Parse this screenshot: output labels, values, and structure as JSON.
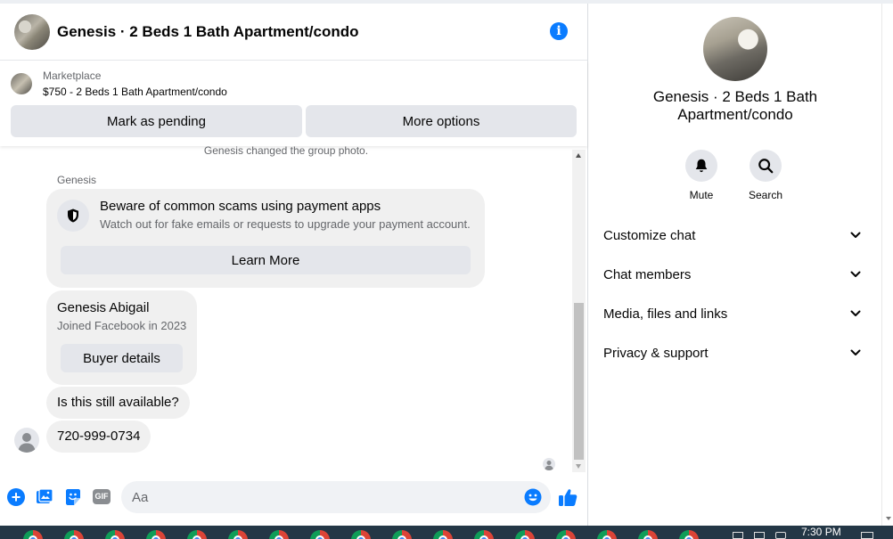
{
  "chat": {
    "title": "Genesis · 2 Beds 1 Bath Apartment/condo",
    "listing": {
      "source": "Marketplace",
      "title": "$750 - 2 Beds 1 Bath Apartment/condo"
    },
    "buttons": {
      "mark_pending": "Mark as pending",
      "more_options": "More options"
    },
    "system_note": "Genesis changed the group photo.",
    "sender_name": "Genesis",
    "scam_notice": {
      "title": "Beware of common scams using payment apps",
      "body": "Watch out for fake emails or requests to upgrade your payment account.",
      "button": "Learn More"
    },
    "buyer": {
      "name": "Genesis Abigail",
      "joined": "Joined Facebook in 2023",
      "button": "Buyer details"
    },
    "messages": [
      {
        "text": "Is this still available?"
      },
      {
        "text": "720-999-0734"
      }
    ],
    "composer": {
      "placeholder": "Aa",
      "gif_label": "GIF"
    }
  },
  "details": {
    "title": "Genesis · 2 Beds 1 Bath Apartment/condo",
    "actions": [
      {
        "label": "Mute",
        "icon": "bell-icon"
      },
      {
        "label": "Search",
        "icon": "search-icon"
      }
    ],
    "menu": [
      {
        "label": "Customize chat"
      },
      {
        "label": "Chat members"
      },
      {
        "label": "Media, files and links"
      },
      {
        "label": "Privacy & support"
      }
    ]
  },
  "taskbar": {
    "clock": "7:30 PM"
  },
  "colors": {
    "accent": "#0a7cff",
    "bubble": "#f0f0f0",
    "button": "#e4e6eb",
    "taskbar": "#243746"
  }
}
